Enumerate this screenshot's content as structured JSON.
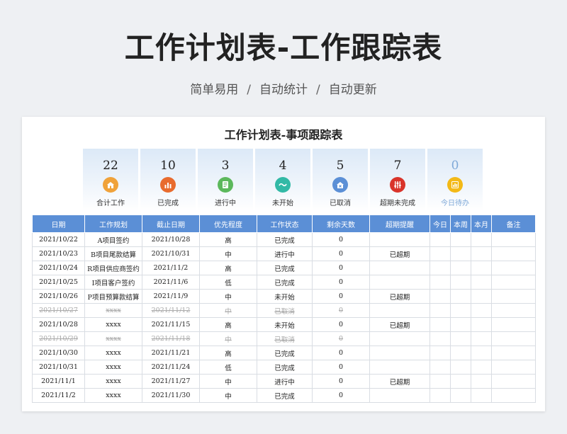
{
  "header": {
    "title": "工作计划表-工作跟踪表",
    "subtitle_parts": [
      "简单易用",
      "自动统计",
      "自动更新"
    ],
    "separator": "/"
  },
  "sheet": {
    "title": "工作计划表-事项跟踪表",
    "cards": [
      {
        "value": "22",
        "label": "合计工作",
        "icon": "house-icon",
        "color": "#f0a23a"
      },
      {
        "value": "10",
        "label": "已完成",
        "icon": "bar-chart-icon",
        "color": "#e86b2e"
      },
      {
        "value": "3",
        "label": "进行中",
        "icon": "document-icon",
        "color": "#5cb85c"
      },
      {
        "value": "4",
        "label": "未开始",
        "icon": "wave-icon",
        "color": "#32b9a6"
      },
      {
        "value": "5",
        "label": "已取消",
        "icon": "home-cancel-icon",
        "color": "#5b8fd6"
      },
      {
        "value": "7",
        "label": "超期未完成",
        "icon": "sliders-icon",
        "color": "#d9342b"
      },
      {
        "value": "0",
        "label": "今日待办",
        "icon": "chart-icon",
        "color": "#f3b917"
      }
    ],
    "columns": [
      "日期",
      "工作规划",
      "截止日期",
      "优先程度",
      "工作状态",
      "剩余天数",
      "超期提醒",
      "今日",
      "本周",
      "本月",
      "备注"
    ],
    "rows": [
      {
        "date": "2021/10/22",
        "plan": "A项目签约",
        "due": "2021/10/28",
        "priority": "高",
        "status": "已完成",
        "remain": "0",
        "overdue": "",
        "today": "",
        "week": "",
        "month": "",
        "note": "",
        "cancelled": false
      },
      {
        "date": "2021/10/23",
        "plan": "B项目尾款结算",
        "due": "2021/10/31",
        "priority": "中",
        "status": "进行中",
        "remain": "0",
        "overdue": "已超期",
        "today": "",
        "week": "",
        "month": "",
        "note": "",
        "cancelled": false
      },
      {
        "date": "2021/10/24",
        "plan": "R项目供应商签约",
        "due": "2021/11/2",
        "priority": "高",
        "status": "已完成",
        "remain": "0",
        "overdue": "",
        "today": "",
        "week": "",
        "month": "",
        "note": "",
        "cancelled": false
      },
      {
        "date": "2021/10/25",
        "plan": "I项目客户签约",
        "due": "2021/11/6",
        "priority": "低",
        "status": "已完成",
        "remain": "0",
        "overdue": "",
        "today": "",
        "week": "",
        "month": "",
        "note": "",
        "cancelled": false
      },
      {
        "date": "2021/10/26",
        "plan": "P项目预算款结算",
        "due": "2021/11/9",
        "priority": "中",
        "status": "未开始",
        "remain": "0",
        "overdue": "已超期",
        "today": "",
        "week": "",
        "month": "",
        "note": "",
        "cancelled": false
      },
      {
        "date": "2021/10/27",
        "plan": "xxxx",
        "due": "2021/11/12",
        "priority": "中",
        "status": "已取消",
        "remain": "0",
        "overdue": "",
        "today": "",
        "week": "",
        "month": "",
        "note": "",
        "cancelled": true
      },
      {
        "date": "2021/10/28",
        "plan": "xxxx",
        "due": "2021/11/15",
        "priority": "高",
        "status": "未开始",
        "remain": "0",
        "overdue": "已超期",
        "today": "",
        "week": "",
        "month": "",
        "note": "",
        "cancelled": false
      },
      {
        "date": "2021/10/29",
        "plan": "xxxx",
        "due": "2021/11/18",
        "priority": "中",
        "status": "已取消",
        "remain": "0",
        "overdue": "",
        "today": "",
        "week": "",
        "month": "",
        "note": "",
        "cancelled": true
      },
      {
        "date": "2021/10/30",
        "plan": "xxxx",
        "due": "2021/11/21",
        "priority": "高",
        "status": "已完成",
        "remain": "0",
        "overdue": "",
        "today": "",
        "week": "",
        "month": "",
        "note": "",
        "cancelled": false
      },
      {
        "date": "2021/10/31",
        "plan": "xxxx",
        "due": "2021/11/24",
        "priority": "低",
        "status": "已完成",
        "remain": "0",
        "overdue": "",
        "today": "",
        "week": "",
        "month": "",
        "note": "",
        "cancelled": false
      },
      {
        "date": "2021/11/1",
        "plan": "xxxx",
        "due": "2021/11/27",
        "priority": "中",
        "status": "进行中",
        "remain": "0",
        "overdue": "已超期",
        "today": "",
        "week": "",
        "month": "",
        "note": "",
        "cancelled": false
      },
      {
        "date": "2021/11/2",
        "plan": "xxxx",
        "due": "2021/11/30",
        "priority": "中",
        "status": "已完成",
        "remain": "0",
        "overdue": "",
        "today": "",
        "week": "",
        "month": "",
        "note": "",
        "cancelled": false
      }
    ]
  }
}
